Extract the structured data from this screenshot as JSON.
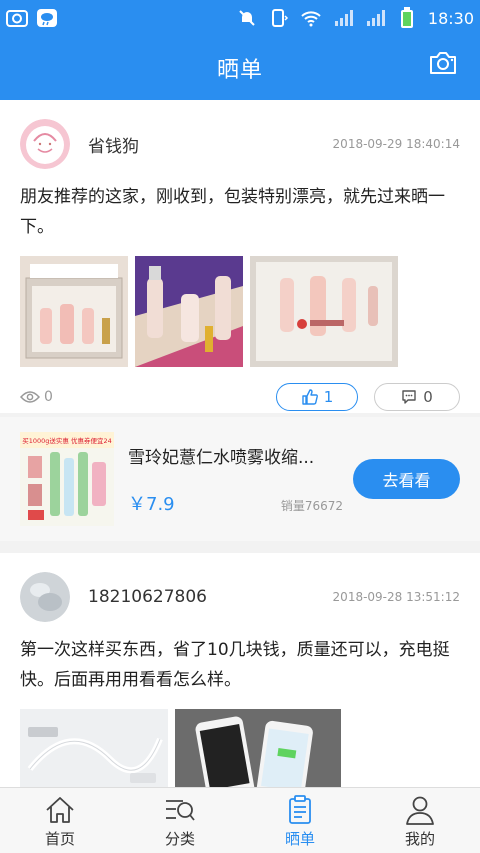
{
  "status_bar": {
    "time": "18:30"
  },
  "header": {
    "title": "晒单"
  },
  "posts": [
    {
      "username": "省钱狗",
      "time": "2018-09-29 18:40:14",
      "text": "朋友推荐的这家，刚收到，包装特别漂亮，就先过来晒一下。",
      "views": "0",
      "likes": "1",
      "comments": "0",
      "product": {
        "thumb_text": "买1000g送实惠 优惠券便宜24",
        "title": "雪玲妃薏仁水喷雾收缩...",
        "price": "￥7.9",
        "sales": "销量76672",
        "button_label": "去看看"
      }
    },
    {
      "username": "18210627806",
      "time": "2018-09-28 13:51:12",
      "text": "第一次这样买东西，省了10几块钱，质量还可以，充电挺快。后面再用用看看怎么样。"
    }
  ],
  "tabs": [
    {
      "label": "首页",
      "icon": "home-icon"
    },
    {
      "label": "分类",
      "icon": "category-search-icon"
    },
    {
      "label": "晒单",
      "icon": "show-order-icon"
    },
    {
      "label": "我的",
      "icon": "user-icon"
    }
  ],
  "colors": {
    "primary": "#2a8ef0",
    "background": "#f2f2f2"
  }
}
